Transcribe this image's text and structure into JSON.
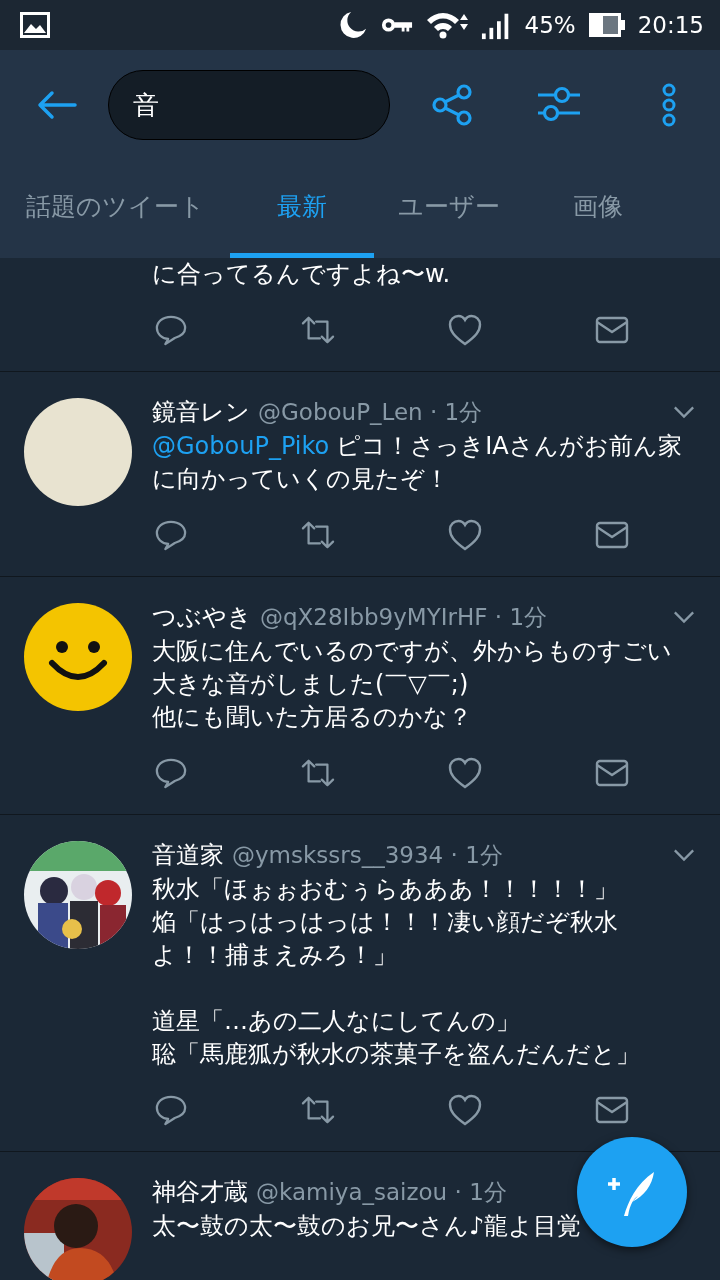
{
  "status_bar": {
    "battery": "45%",
    "time": "20:15"
  },
  "header": {
    "search_value": "音"
  },
  "tabs": [
    {
      "label": "話題のツイート",
      "selected": false
    },
    {
      "label": "最新",
      "selected": true
    },
    {
      "label": "ユーザー",
      "selected": false
    },
    {
      "label": "画像",
      "selected": false
    }
  ],
  "tweets": [
    {
      "kind": "cut",
      "paragraphs": [
        [
          "に合ってるんですよね〜w."
        ]
      ]
    },
    {
      "kind": "full",
      "name": "鏡音レン",
      "handle": "@GobouP_Len · 1分",
      "mention": "@GobouP_Piko",
      "paragraphs": [
        [
          "ピコ！さっきIAさんがお前ん家",
          "に向かっていくの見たぞ！"
        ]
      ]
    },
    {
      "kind": "full",
      "name": "つぶやき",
      "handle": "@qX28Ibb9yMYIrHF · 1分",
      "paragraphs": [
        [
          "大阪に住んでいるのですが、外からものすごい",
          "大きな音がしました(￣▽￣;)",
          "他にも聞いた方居るのかな？"
        ]
      ]
    },
    {
      "kind": "full",
      "name": "音道家",
      "handle": "@ymskssrs__3934 · 1分",
      "paragraphs": [
        [
          "秋水「ほぉぉおむぅらあああ！！！！！」",
          "焔「はっはっはっは！！！凄い顔だぞ秋水",
          "よ！！捕まえみろ！」"
        ],
        [
          "道星「…あの二人なにしてんの」",
          "聡「馬鹿狐が秋水の茶菓子を盗んだんだと」"
        ]
      ]
    },
    {
      "kind": "last",
      "name": "神谷才蔵",
      "handle": "@kamiya_saizou · 1分",
      "paragraphs": [
        [
          "太〜鼓の太〜鼓のお兄〜さん♪龍よ目覚"
        ]
      ]
    }
  ]
}
